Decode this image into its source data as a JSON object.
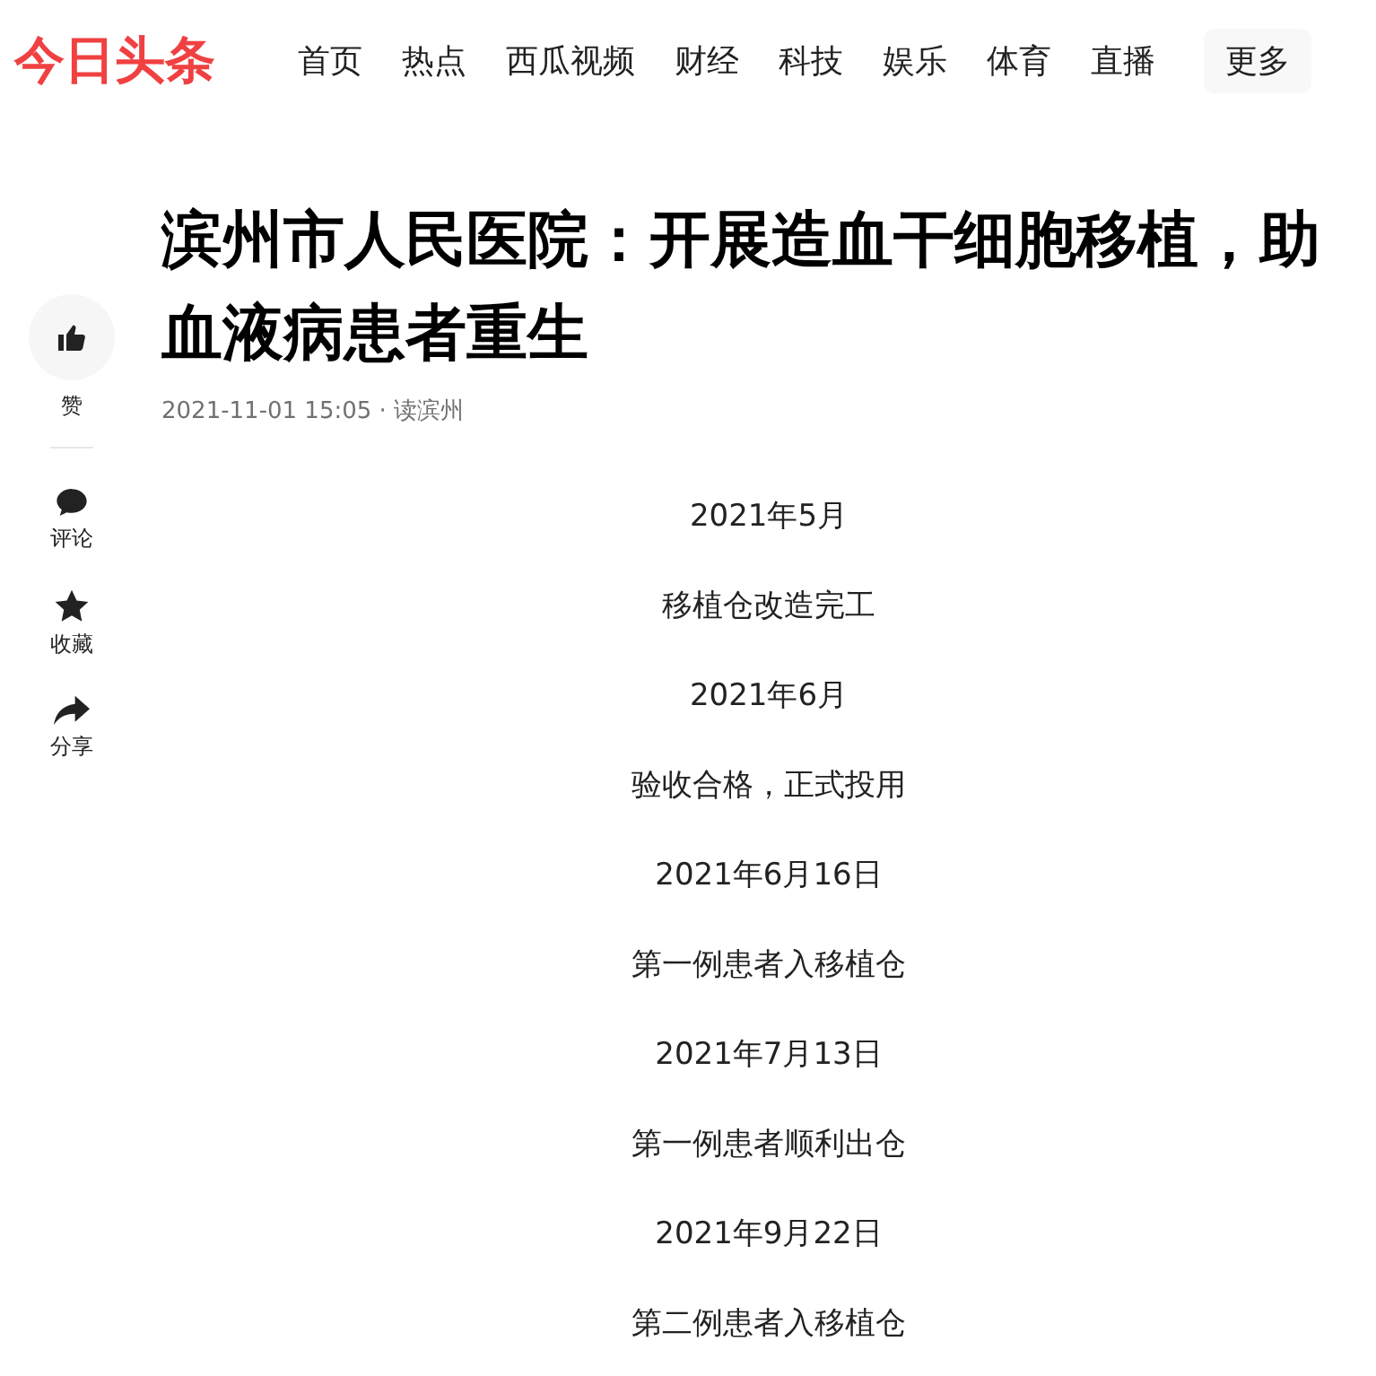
{
  "logo": "今日头条",
  "nav": [
    {
      "label": "首页"
    },
    {
      "label": "热点"
    },
    {
      "label": "西瓜视频"
    },
    {
      "label": "财经"
    },
    {
      "label": "科技"
    },
    {
      "label": "娱乐"
    },
    {
      "label": "体育"
    },
    {
      "label": "直播"
    }
  ],
  "more_button": "更多",
  "actions": [
    {
      "kind": "like",
      "label": "赞"
    },
    {
      "kind": "comment",
      "label": "评论"
    },
    {
      "kind": "favorite",
      "label": "收藏"
    },
    {
      "kind": "share",
      "label": "分享"
    }
  ],
  "article": {
    "title": "滨州市人民医院：开展造血干细胞移植，助血液病患者重生",
    "meta": "2021-11-01 15:05 · 读滨州",
    "paragraphs": [
      "2021年5月",
      "移植仓改造完工",
      "2021年6月",
      "验收合格，正式投用",
      "2021年6月16日",
      "第一例患者入移植仓",
      "2021年7月13日",
      "第一例患者顺利出仓",
      "2021年9月22日",
      "第二例患者入移植仓"
    ]
  }
}
